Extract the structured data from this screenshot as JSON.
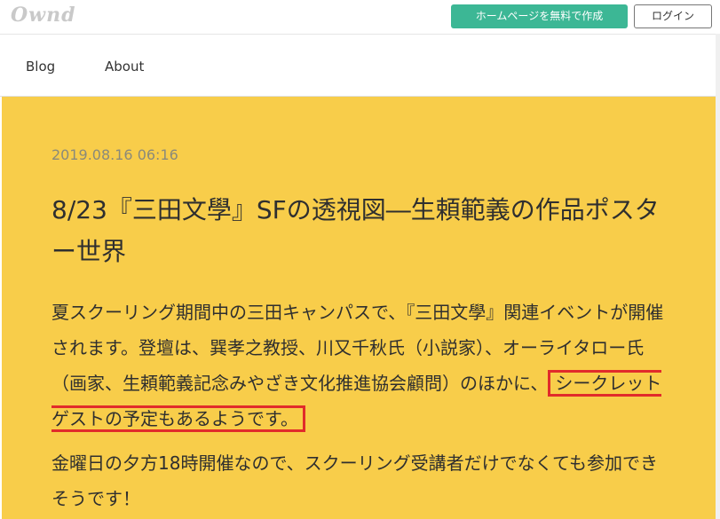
{
  "header": {
    "logo": "Ownd",
    "cta_label": "ホームページを無料で作成",
    "login_label": "ログイン"
  },
  "nav": {
    "items": [
      {
        "label": "Blog"
      },
      {
        "label": "About"
      }
    ]
  },
  "post": {
    "date": "2019.08.16 06:16",
    "title": "8/23『三田文學』SFの透視図―生頼範義の作品ポスター世界",
    "paragraph1_text": "夏スクーリング期間中の三田キャンパスで、『三田文學』関連イベントが開催されます。登壇は、巽孝之教授、川又千秋氏（小説家）、オーライタロー氏（画家、生頼範義記念みやざき文化推進協会顧問）のほかに、",
    "paragraph1_highlight": "シークレットゲストの予定もあるようです。",
    "paragraph2": "金曜日の夕方18時開催なので、スクーリング受講者だけでなくても参加できそうです！"
  },
  "colors": {
    "background": "#f8cd4a",
    "cta": "#3cb795",
    "highlight_border": "#e12b2b"
  }
}
